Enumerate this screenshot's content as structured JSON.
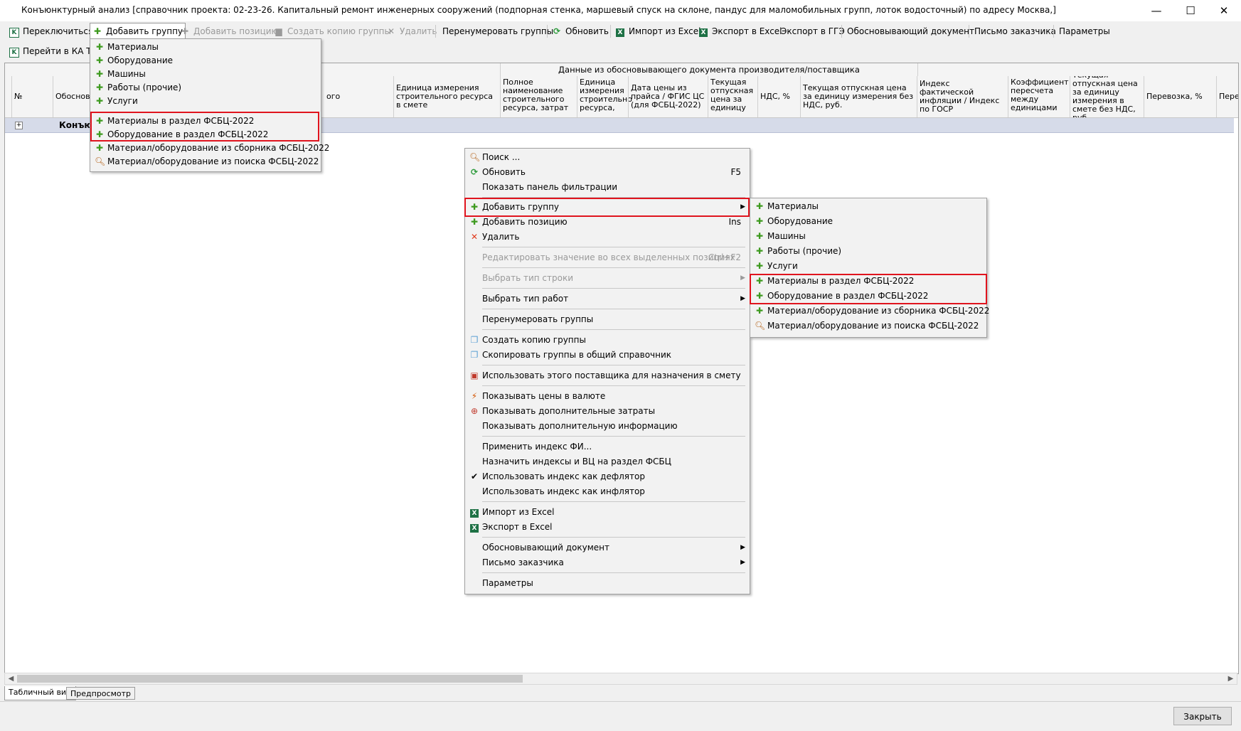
{
  "window": {
    "title": "Конъюнктурный анализ [справочник проекта: 02-23-26. Капитальный ремонт инженерных сооружений (подпорная стенка, маршевый спуск на склоне, пандус для маломобильных групп, лоток водосточный) по адресу Москва,]",
    "minimize": "—",
    "maximize": "☐",
    "close": "✕"
  },
  "toolbar1": {
    "switch": "Переключиться",
    "add_group": "Добавить группу",
    "add_position": "Добавить позицию",
    "create_copy": "Создать копию группы",
    "delete": "Удалить",
    "renumber": "Перенумеровать группы",
    "refresh": "Обновить",
    "import_excel": "Импорт из Excel",
    "export_excel": "Экспорт в Excel",
    "export_gge": "Экспорт в ГГЭ",
    "justifying_doc": "Обосновывающий документ",
    "customer_letter": "Письмо заказчика",
    "params": "Параметры"
  },
  "toolbar2": {
    "goto_ka": "Перейти в КА ТСН"
  },
  "grid": {
    "group_header": "Данные из обосновывающего документа производителя/поставщика",
    "columns": {
      "num": "№",
      "basis": "Обоснов",
      "partial": "ого",
      "unit_in_estimate": "Единица измерения строительного ресурса в смете",
      "full_name": "Полное наименование строительного ресурса, затрат",
      "unit": "Единица измерения строительног ресурса,",
      "price_date": "Дата цены из прайса / ФГИС ЦС (для ФСБЦ-2022)",
      "current_price": "Текущая отпускная цена за единицу",
      "vat": "НДС, %",
      "current_price_no_vat": "Текущая отпускная цена за единицу измерения без НДС, руб.",
      "inflation_index": "Индекс фактической инфляции / Индекс по ГОСР",
      "conversion_coef": "Коэффициент пересчета между единицами",
      "estimate_price": "Текущая отпускная цена за единицу измерения в смете без НДС, руб.",
      "transport": "Перевозка, %",
      "next": "Пере"
    },
    "row": {
      "expander": "+",
      "label": "Конъюн"
    }
  },
  "toolbar_dropdown": {
    "items": [
      "Материалы",
      "Оборудование",
      "Машины",
      "Работы (прочие)",
      "Услуги",
      "Материалы в раздел ФСБЦ-2022",
      "Оборудование в раздел ФСБЦ-2022",
      "Материал/оборудование из сборника ФСБЦ-2022",
      "Материал/оборудование из поиска ФСБЦ-2022"
    ]
  },
  "context_menu": {
    "search": "Поиск ...",
    "refresh": "Обновить",
    "refresh_key": "F5",
    "show_filter": "Показать панель фильтрации",
    "add_group": "Добавить группу",
    "add_position": "Добавить позицию",
    "add_position_key": "Ins",
    "delete": "Удалить",
    "edit_all": "Редактировать значение во всех выделенных позициях",
    "edit_all_key": "Ctrl+F2",
    "select_row_type": "Выбрать тип строки",
    "select_work_type": "Выбрать тип работ",
    "renumber": "Перенумеровать группы",
    "create_copy": "Создать копию группы",
    "copy_to_common": "Скопировать группы в общий справочник",
    "use_supplier": "Использовать этого поставщика для назначения в смету",
    "show_currency": "Показывать цены в валюте",
    "show_extra_costs": "Показывать дополнительные затраты",
    "show_extra_info": "Показывать дополнительную информацию",
    "apply_index": "Применить индекс ФИ...",
    "assign_indexes": "Назначить индексы и ВЦ на раздел ФСБЦ",
    "use_deflator": "Использовать индекс как дефлятор",
    "use_inflator": "Использовать индекс как инфлятор",
    "import_excel": "Импорт из Excel",
    "export_excel": "Экспорт в Excel",
    "justifying_doc": "Обосновывающий документ",
    "customer_letter": "Письмо заказчика",
    "params": "Параметры"
  },
  "submenu": {
    "items": [
      "Материалы",
      "Оборудование",
      "Машины",
      "Работы (прочие)",
      "Услуги",
      "Материалы в раздел ФСБЦ-2022",
      "Оборудование в раздел ФСБЦ-2022",
      "Материал/оборудование из сборника ФСБЦ-2022",
      "Материал/оборудование из поиска ФСБЦ-2022"
    ]
  },
  "tabs": {
    "table_view": "Табличный вид",
    "preview": "Предпросмотр"
  },
  "footer": {
    "close": "Закрыть"
  },
  "colors": {
    "highlight_red": "#e0141e",
    "row_band": "#d6dbe9",
    "plus_green": "#3e9a1f"
  }
}
